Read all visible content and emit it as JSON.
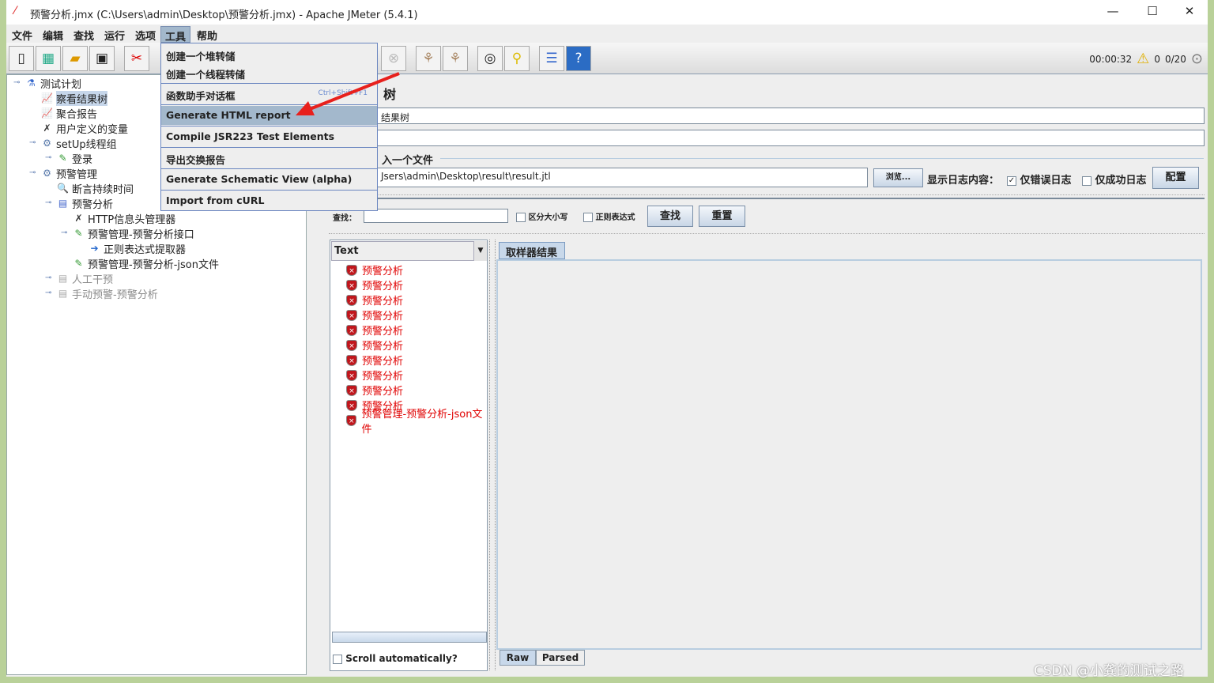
{
  "window": {
    "title": "预警分析.jmx (C:\\Users\\admin\\Desktop\\预警分析.jmx) - Apache JMeter (5.4.1)",
    "minimize": "—",
    "maximize": "☐",
    "close": "✕"
  },
  "menubar": [
    "文件",
    "编辑",
    "查找",
    "运行",
    "选项",
    "工具",
    "帮助"
  ],
  "tools_menu": {
    "items": [
      {
        "label": "创建一个堆转储"
      },
      {
        "label": "创建一个线程转储"
      },
      {
        "label": "函数助手对话框",
        "shortcut": "Ctrl+Shift+F1"
      },
      {
        "label": "Generate HTML report",
        "highlighted": true
      },
      {
        "label": "Compile JSR223 Test Elements"
      },
      {
        "label": "导出交换报告"
      },
      {
        "label": "Generate Schematic View (alpha)"
      },
      {
        "label": "Import from cURL"
      }
    ]
  },
  "status": {
    "elapsed": "00:00:32",
    "warnings": "0",
    "threads": "0/20"
  },
  "tree": [
    {
      "label": "测试计划",
      "icon": "flask-icon",
      "level": 0
    },
    {
      "label": "察看结果树",
      "icon": "graph-icon",
      "level": 1,
      "selected": true
    },
    {
      "label": "聚合报告",
      "icon": "graph-icon",
      "level": 1
    },
    {
      "label": "用户定义的变量",
      "icon": "tools-icon",
      "level": 1
    },
    {
      "label": "setUp线程组",
      "icon": "gear-icon",
      "level": 1
    },
    {
      "label": "登录",
      "icon": "pipette-icon",
      "level": 2
    },
    {
      "label": "预警管理",
      "icon": "gear-icon",
      "level": 1
    },
    {
      "label": "断言持续时间",
      "icon": "magnifier-icon",
      "level": 2
    },
    {
      "label": "预警分析",
      "icon": "controller-icon",
      "level": 2
    },
    {
      "label": "HTTP信息头管理器",
      "icon": "tools-icon",
      "level": 3
    },
    {
      "label": "预警管理-预警分析接口",
      "icon": "pipette-icon",
      "level": 3
    },
    {
      "label": "正则表达式提取器",
      "icon": "extractor-icon",
      "level": 4
    },
    {
      "label": "预警管理-预警分析-json文件",
      "icon": "pipette-icon",
      "level": 3
    },
    {
      "label": "人工干预",
      "icon": "controller-icon",
      "level": 2,
      "disabled": true
    },
    {
      "label": "手动预警-预警分析",
      "icon": "controller-icon",
      "level": 2,
      "disabled": true
    }
  ],
  "panel": {
    "title_partial": "树",
    "name_partial": "结果树",
    "file_legend_partial": "入一个文件",
    "filename_partial": "Jsers\\admin\\Desktop\\result\\result.jtl",
    "browse": "浏览...",
    "log_label": "显示日志内容：",
    "errors_only": "仅错误日志",
    "errors_only_checked": true,
    "success_only": "仅成功日志",
    "success_only_checked": false,
    "configure": "配置"
  },
  "search": {
    "label": "查找：",
    "value": "",
    "case": "区分大小写",
    "regex": "正则表达式",
    "find": "查找",
    "reset": "重置"
  },
  "results": {
    "renderer": "Text",
    "items": [
      "预警分析",
      "预警分析",
      "预警分析",
      "预警分析",
      "预警分析",
      "预警分析",
      "预警分析",
      "预警分析",
      "预警分析",
      "预警分析",
      "预警管理-预警分析-json文件"
    ],
    "scroll_auto": "Scroll automatically?",
    "tab": "取样器结果",
    "bottom_tabs": [
      "Raw",
      "Parsed"
    ]
  },
  "watermark": "CSDN @小龚的测试之路",
  "colors": {
    "menu_highlight": "#a3b8cc",
    "error_text": "#e00000",
    "arrow": "#e8201c"
  }
}
